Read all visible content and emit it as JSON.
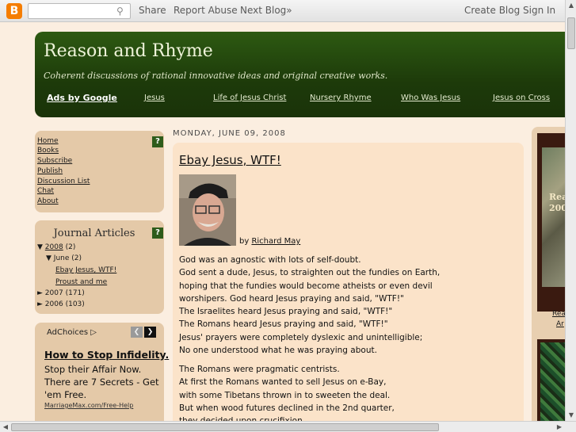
{
  "navbar": {
    "search_placeholder": "",
    "share": "Share",
    "report_abuse": "Report Abuse",
    "next_blog": "Next Blog»",
    "create_blog": "Create Blog",
    "sign_in": "Sign In",
    "logo_letter": "B"
  },
  "header": {
    "title": "Reason and Rhyme",
    "description": "Coherent discussions of rational innovative ideas and original creative works.",
    "ads_by_google": "Ads by Google",
    "ad_links": [
      "Jesus",
      "Life of Jesus Christ",
      "Nursery Rhyme",
      "Who Was Jesus",
      "Jesus on Cross"
    ]
  },
  "sidebar": {
    "nav_links": [
      "Home",
      "Books",
      "Subscribe",
      "Publish",
      "Discussion List",
      "Chat",
      "About"
    ],
    "help_icon": "?",
    "archive_title": "Journal Articles",
    "archive": {
      "y2008": "2008",
      "y2008_count": "(2)",
      "june": "June",
      "june_count": "(2)",
      "post1": "Ebay Jesus, WTF!",
      "post2": "Proust and me",
      "y2007": "2007",
      "y2007_count": "(171)",
      "y2006": "2006",
      "y2006_count": "(103)"
    },
    "ad": {
      "adchoices": "AdChoices",
      "title": "How to Stop Infidelity.",
      "text": "Stop their Affair Now. There are 7 Secrets - Get 'em Free.",
      "url": "MarriageMax.com/Free-Help"
    }
  },
  "post": {
    "date": "MONDAY, JUNE 09, 2008",
    "title": "Ebay Jesus, WTF!",
    "by": "by",
    "author": "Richard May",
    "para1": [
      "God was an agnostic with lots of self-doubt.",
      "God sent a dude, Jesus, to straighten out the fundies on Earth,",
      "hoping that the fundies would become atheists or even devil",
      "worshipers. God heard Jesus praying and said, \"WTF!\"",
      "The Israelites heard Jesus praying and said, \"WTF!\"",
      "The Romans heard Jesus praying and said, \"WTF!\"",
      "Jesus' prayers were completely dyslexic and unintelligible;",
      "No one understood what he was praying about."
    ],
    "para2": [
      "The Romans were pragmatic centrists.",
      "At first the Romans wanted to sell Jesus on e-Bay,",
      "with some Tibetans thrown in to sweeten the deal.",
      "But when wood futures declined in the 2nd quarter,",
      "they decided upon crucifixion."
    ]
  },
  "rightcol": {
    "img_text1": "Rea",
    "img_text2": "200",
    "link1": "Rea",
    "link2": "Ar"
  }
}
